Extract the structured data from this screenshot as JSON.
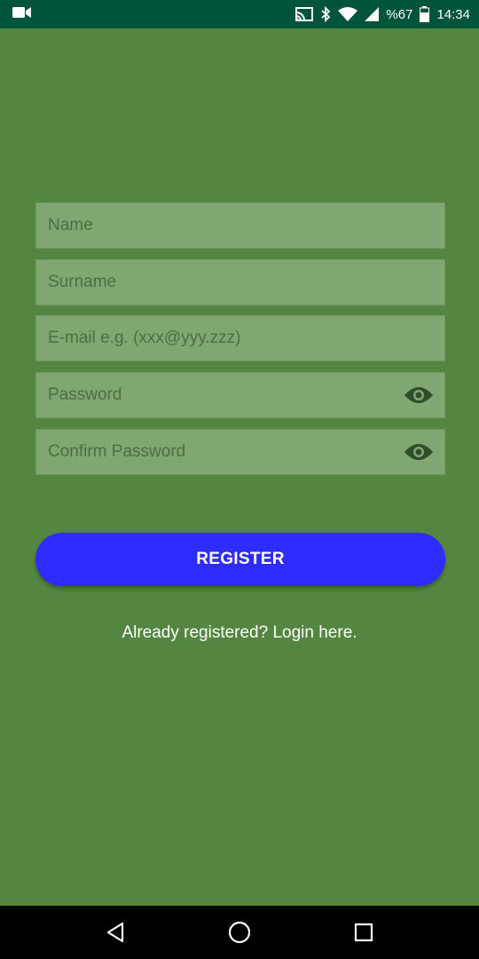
{
  "status_bar": {
    "battery_text": "%67",
    "time": "14:34",
    "icons": [
      "video-camera-icon",
      "cast-icon",
      "bluetooth-icon",
      "wifi-icon",
      "signal-icon",
      "battery-icon"
    ]
  },
  "form": {
    "name_placeholder": "Name",
    "surname_placeholder": "Surname",
    "email_placeholder": "E-mail e.g. (xxx@yyy.zzz)",
    "password_placeholder": "Password",
    "confirm_password_placeholder": "Confirm Password"
  },
  "register_label": "REGISTER",
  "login_link": "Already registered? Login here.",
  "nav": {
    "icons": [
      "back-icon",
      "home-icon",
      "recents-icon"
    ]
  },
  "colors": {
    "status_bar": "#00543c",
    "background": "#548641",
    "field": "#80a772",
    "button": "#2e2cff"
  }
}
